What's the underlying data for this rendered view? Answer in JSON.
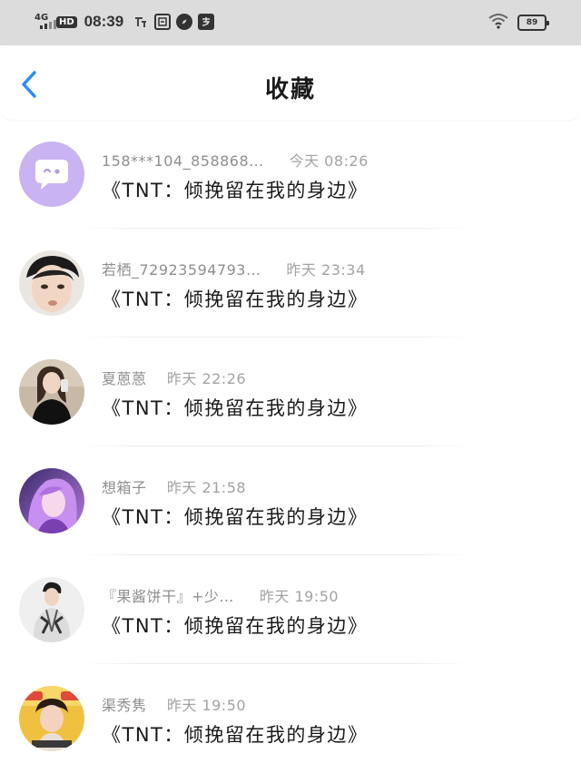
{
  "status_bar": {
    "network": "4G",
    "hd_badge": "HD",
    "time": "08:39",
    "battery": "89"
  },
  "header": {
    "title": "收藏"
  },
  "colors": {
    "accent": "#2d8cf0",
    "status_bar_bg": "#dcdcdc",
    "meta_text": "#8f8f8f"
  },
  "favorites": [
    {
      "name": "158***104_858868…",
      "time": "今天 08:26",
      "message": "《TNT：倾挽留在我的身边》"
    },
    {
      "name": "若栖_72923594793…",
      "time": "昨天 23:34",
      "message": "《TNT：倾挽留在我的身边》"
    },
    {
      "name": "夏蒽蒽",
      "time": "昨天 22:26",
      "message": "《TNT：倾挽留在我的身边》"
    },
    {
      "name": "想箱子",
      "time": "昨天 21:58",
      "message": "《TNT：倾挽留在我的身边》"
    },
    {
      "name": "『果酱饼干』+少…",
      "time": "昨天 19:50",
      "message": "《TNT：倾挽留在我的身边》"
    },
    {
      "name": "渠秀隽",
      "time": "昨天 19:50",
      "message": "《TNT：倾挽留在我的身边》"
    }
  ]
}
